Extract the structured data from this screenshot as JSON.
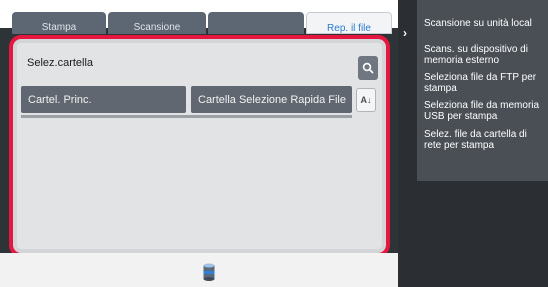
{
  "tabs": [
    {
      "label": "Stampa"
    },
    {
      "label": "Scansione"
    },
    {
      "label": ""
    },
    {
      "label": "Rep. il file"
    }
  ],
  "dialog": {
    "path_label": "Selez.cartella",
    "folders": [
      {
        "label": "Cartel. Princ."
      },
      {
        "label": "Cartella Selezione Rapida File"
      }
    ],
    "sort_label": "A↓"
  },
  "menu": {
    "items": [
      {
        "label": "Scansione su unità local"
      },
      {
        "label": "Scans. su dispositivo di memoria esterno"
      },
      {
        "label": "Seleziona file da FTP per stampa"
      },
      {
        "label": "Seleziona file da memoria USB per stampa"
      },
      {
        "label": "Selez. file da cartella di rete per stampa"
      }
    ]
  },
  "colors": {
    "highlight": "#e5173f",
    "active_tab_text": "#2a7bd3",
    "menu_bg": "#4a4f56"
  }
}
